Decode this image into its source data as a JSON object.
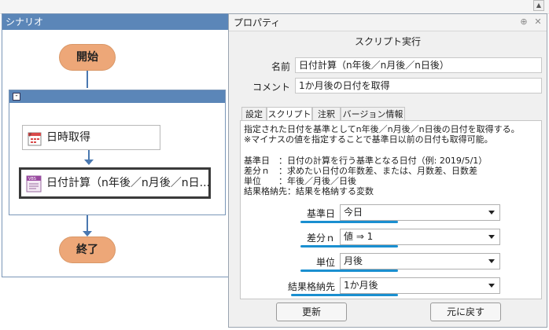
{
  "scenario": {
    "title": "シナリオ",
    "start_label": "開始",
    "group_collapse_glyph": "-",
    "actions": [
      {
        "label": "日時取得",
        "icon": "calendar-icon"
      },
      {
        "label": "日付計算（n年後／n月後／n日...",
        "icon": "vbs-script-icon"
      }
    ],
    "end_label": "終了"
  },
  "properties": {
    "window_title": "プロパティ",
    "pin_glyph": "⊕",
    "close_glyph": "✕",
    "heading": "スクリプト実行",
    "name_label": "名前",
    "name_value": "日付計算（n年後／n月後／n日後）",
    "comment_label": "コメント",
    "comment_value": "1か月後の日付を取得",
    "tabs": [
      "設定",
      "スクリプト",
      "注釈",
      "バージョン情報"
    ],
    "active_tab": "スクリプト",
    "description": [
      "指定された日付を基準としてn年後／n月後／n日後の日付を取得する。",
      "※マイナスの値を指定することで基準日以前の日付も取得可能。",
      "",
      "基準日　：日付の計算を行う基準となる日付（例: 2019/5/1）",
      "差分ｎ　：求めたい日付の年数差、または、月数差、日数差",
      "単位　　：年後／月後／日後",
      "結果格納先：結果を格納する変数"
    ],
    "params": [
      {
        "label": "基準日",
        "value": "今日"
      },
      {
        "label": "差分ｎ",
        "value": "値 ⇒ 1"
      },
      {
        "label": "単位",
        "value": "月後"
      },
      {
        "label": "結果格納先",
        "value": "1か月後"
      }
    ],
    "update_button": "更新",
    "revert_button": "元に戻す"
  },
  "colors": {
    "title_bar": "#5b86b8",
    "start_end_node": "#eda778",
    "connector": "#4a78b0",
    "underline_accent": "#1a8fd0"
  }
}
